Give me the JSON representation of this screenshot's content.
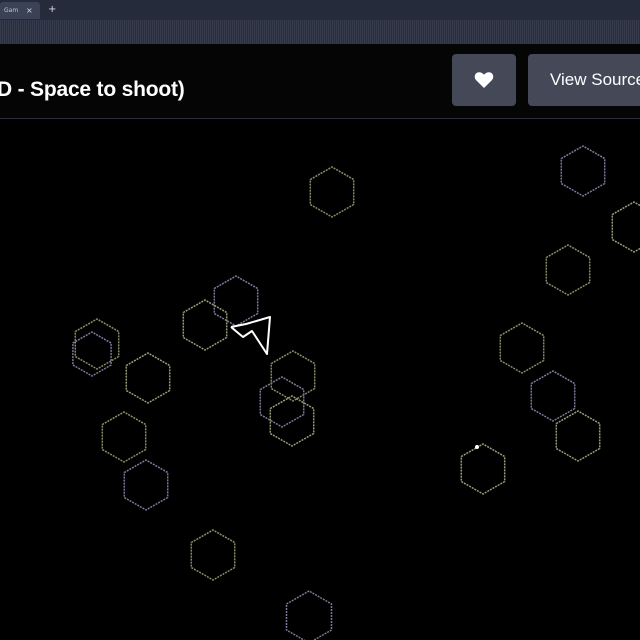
{
  "browser": {
    "tab_label": "Gam",
    "tab_close": "×",
    "new_tab": "+"
  },
  "header": {
    "title": "D - Space to shoot)",
    "favorite_icon": "heart-icon",
    "view_source_label": "View Source"
  },
  "game": {
    "background_color": "#000000",
    "asteroid_shape": "hexagon",
    "asteroid_colors": [
      "#8b8b66",
      "#7a7a9a",
      "#9a9a7a"
    ],
    "ship_color": "#ffffff",
    "bullet_color": "#ffffff"
  }
}
